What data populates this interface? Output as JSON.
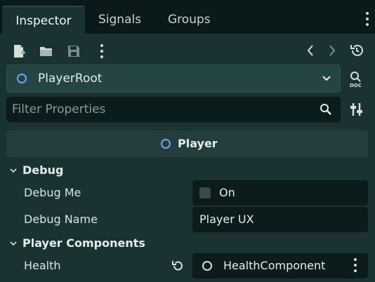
{
  "tabs": [
    {
      "label": "Inspector",
      "active": true
    },
    {
      "label": "Signals"
    },
    {
      "label": "Groups"
    }
  ],
  "toolbar": {
    "icons": [
      "new-resource-icon",
      "open-folder-icon",
      "save-icon",
      "more-icon",
      "back-icon",
      "forward-icon",
      "history-icon"
    ]
  },
  "node_selector": {
    "value": "PlayerRoot",
    "icon": "node-ring-icon"
  },
  "filter": {
    "placeholder": "Filter Properties"
  },
  "section": {
    "label": "Player"
  },
  "groups": [
    {
      "title": "Debug",
      "properties": [
        {
          "label": "Debug Me",
          "value": "On",
          "type": "checkbox",
          "checked": false
        },
        {
          "label": "Debug Name",
          "value": "Player UX",
          "type": "text"
        }
      ]
    },
    {
      "title": "Player Components",
      "properties": [
        {
          "label": "Health",
          "value": "HealthComponent",
          "type": "node"
        }
      ]
    }
  ],
  "colors": {
    "accent": "#6fa7f2",
    "panel": "#1a3232",
    "field": "#0c1b1b"
  }
}
